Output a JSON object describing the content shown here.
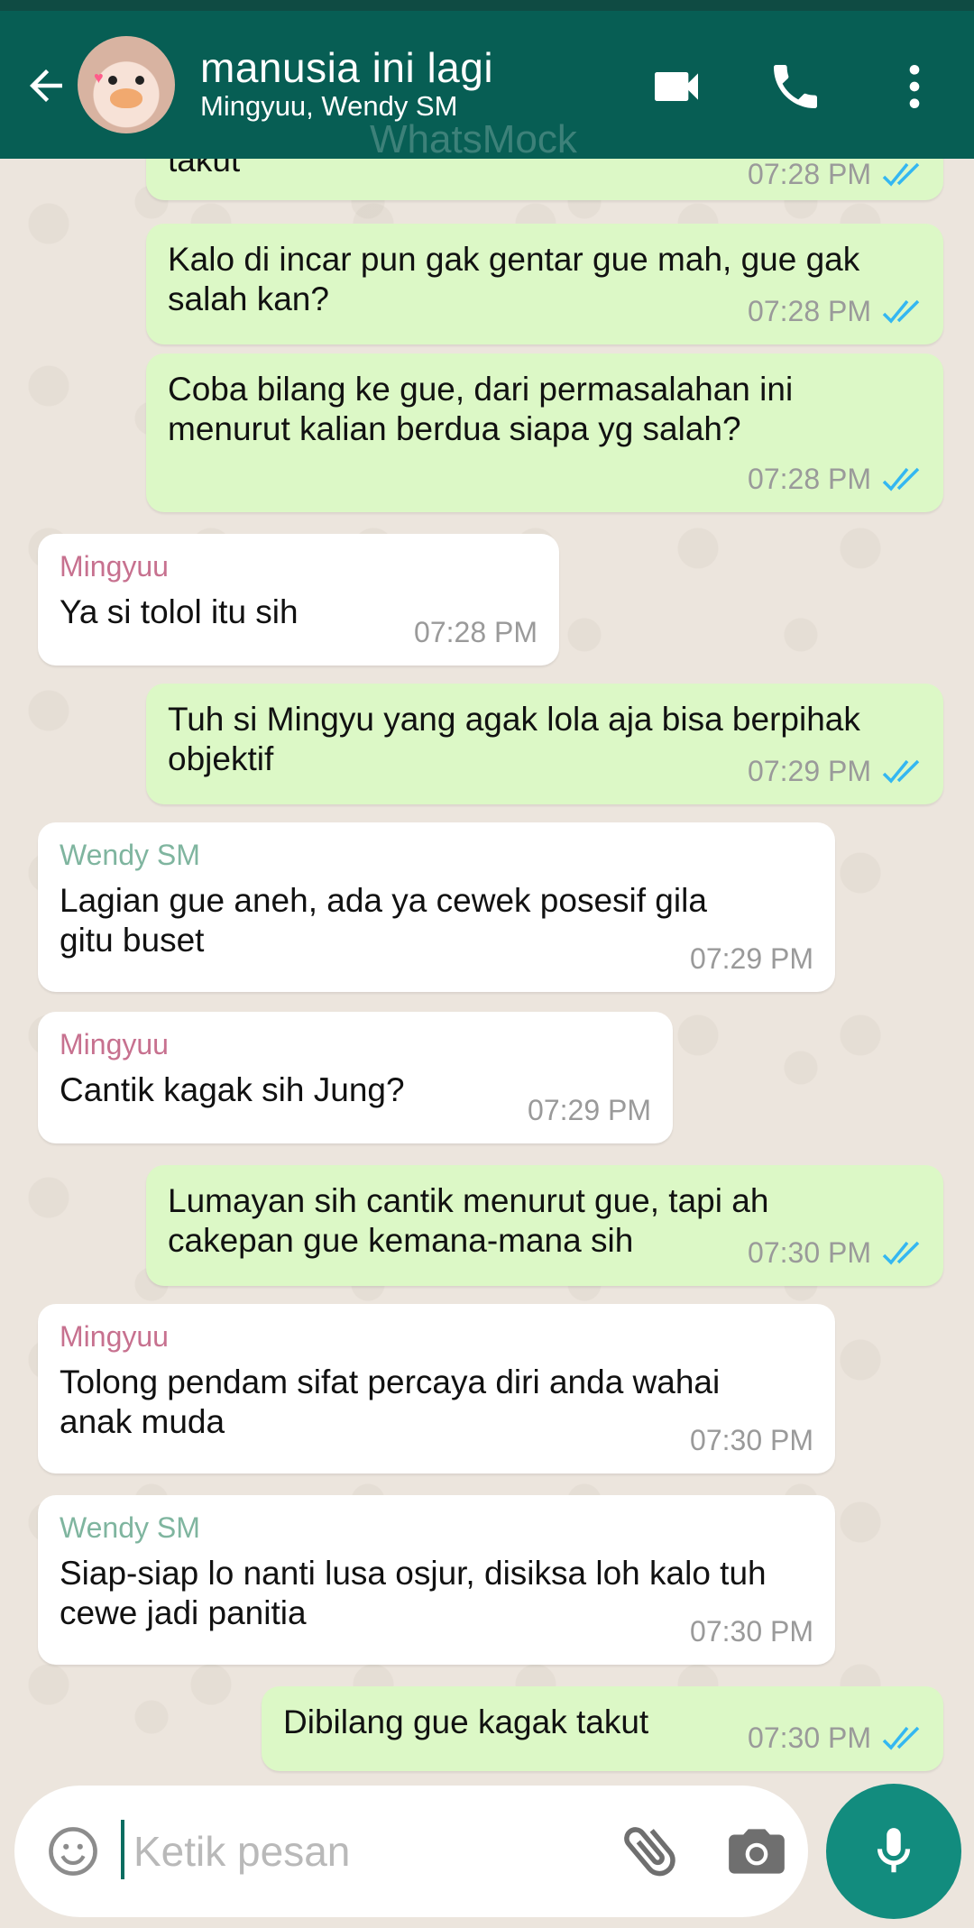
{
  "header": {
    "title": "manusia ini lagi",
    "subtitle": "Mingyuu, Wendy SM",
    "watermark": "WhatsMock",
    "icons": [
      "back-arrow-icon",
      "video-call-icon",
      "phone-call-icon",
      "more-vert-icon"
    ]
  },
  "colors": {
    "header_bg": "#075e54",
    "outgoing_bubble": "#dcf8c6",
    "incoming_bubble": "#ffffff",
    "read_ticks": "#34b7f1",
    "mingyuu_name": "#c7718f",
    "wendy_name": "#7fb59f",
    "mic_button": "#128c7e"
  },
  "messages": [
    {
      "direction": "out",
      "text": "takut",
      "time": "07:28 PM",
      "status": "read"
    },
    {
      "direction": "out",
      "text": "Kalo di incar pun gak gentar gue mah, gue gak salah kan?",
      "time": "07:28 PM",
      "status": "read"
    },
    {
      "direction": "out",
      "text": "Coba bilang ke gue, dari permasalahan ini menurut kalian berdua siapa yg salah?",
      "time": "07:28 PM",
      "status": "read"
    },
    {
      "direction": "in",
      "sender": "Mingyuu",
      "text": "Ya si tolol itu sih",
      "time": "07:28 PM"
    },
    {
      "direction": "out",
      "text": "Tuh si Mingyu yang agak lola aja bisa berpihak objektif",
      "time": "07:29 PM",
      "status": "read"
    },
    {
      "direction": "in",
      "sender": "Wendy SM",
      "text": "Lagian gue aneh, ada ya cewek posesif gila gitu buset",
      "time": "07:29 PM"
    },
    {
      "direction": "in",
      "sender": "Mingyuu",
      "text": "Cantik kagak sih Jung?",
      "time": "07:29 PM"
    },
    {
      "direction": "out",
      "text": "Lumayan sih cantik menurut gue, tapi ah cakepan gue kemana-mana sih",
      "time": "07:30 PM",
      "status": "read"
    },
    {
      "direction": "in",
      "sender": "Mingyuu",
      "text": "Tolong pendam sifat percaya diri anda wahai anak muda",
      "time": "07:30 PM"
    },
    {
      "direction": "in",
      "sender": "Wendy SM",
      "text": "Siap-siap lo nanti lusa osjur, disiksa loh kalo tuh cewe jadi panitia",
      "time": "07:30 PM"
    },
    {
      "direction": "out",
      "text": "Dibilang gue kagak takut",
      "time": "07:30 PM",
      "status": "read"
    }
  ],
  "composer": {
    "placeholder": "Ketik pesan",
    "icons": [
      "emoji-icon",
      "attach-icon",
      "camera-icon",
      "mic-icon"
    ]
  }
}
